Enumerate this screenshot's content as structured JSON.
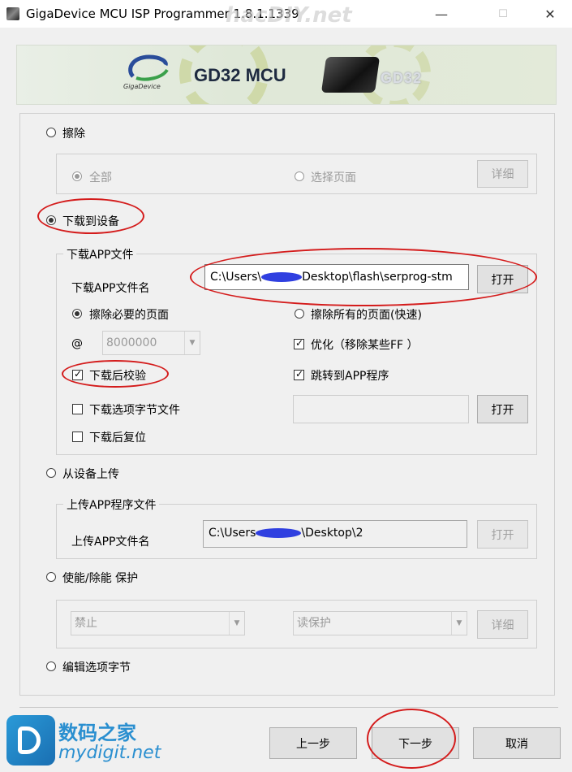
{
  "window": {
    "title": "GigaDevice MCU ISP Programmer 1.8.1.1339",
    "minimize": "—",
    "maximize": "☐",
    "close": "✕"
  },
  "banner": {
    "logo_text": "GigaDevice",
    "title": "GD32 MCU",
    "badge": "GD32"
  },
  "erase": {
    "label": "擦除",
    "full_chip": "全部",
    "select_page": "选择页面",
    "detail_button": "详细"
  },
  "download": {
    "label": "下载到设备",
    "group_title": "下载APP文件",
    "file_name_label": "下载APP文件名",
    "file_path_prefix": "C:\\Users\\",
    "file_path_suffix": "Desktop\\flash\\serprog-stm",
    "open_button": "打开",
    "erase_needed": "擦除必要的页面",
    "erase_all_fast": "擦除所有的页面(快速)",
    "at_label": "@",
    "address": "8000000",
    "optimize": "优化（移除某些FF ）",
    "verify_after": "下载后校验",
    "jump_to_app": "跳转到APP程序",
    "option_bytes_file": "下载选项字节文件",
    "reset_after": "下载后复位",
    "open_button2": "打开"
  },
  "upload": {
    "label": "从设备上传",
    "group_title": "上传APP程序文件",
    "file_name_label": "上传APP文件名",
    "file_path_prefix": "C:\\Users",
    "file_path_suffix": "\\Desktop\\2",
    "open_button": "打开"
  },
  "protect": {
    "label": "使能/除能 保护",
    "select1": "禁止",
    "select2": "读保护",
    "detail_button": "详细"
  },
  "option_bytes": {
    "label": "编辑选项字节"
  },
  "nav": {
    "prev": "上一步",
    "next": "下一步",
    "cancel": "取消"
  },
  "watermark": {
    "title": "数码之家",
    "url": "mydigit.net",
    "site": "hacDIY.net"
  }
}
